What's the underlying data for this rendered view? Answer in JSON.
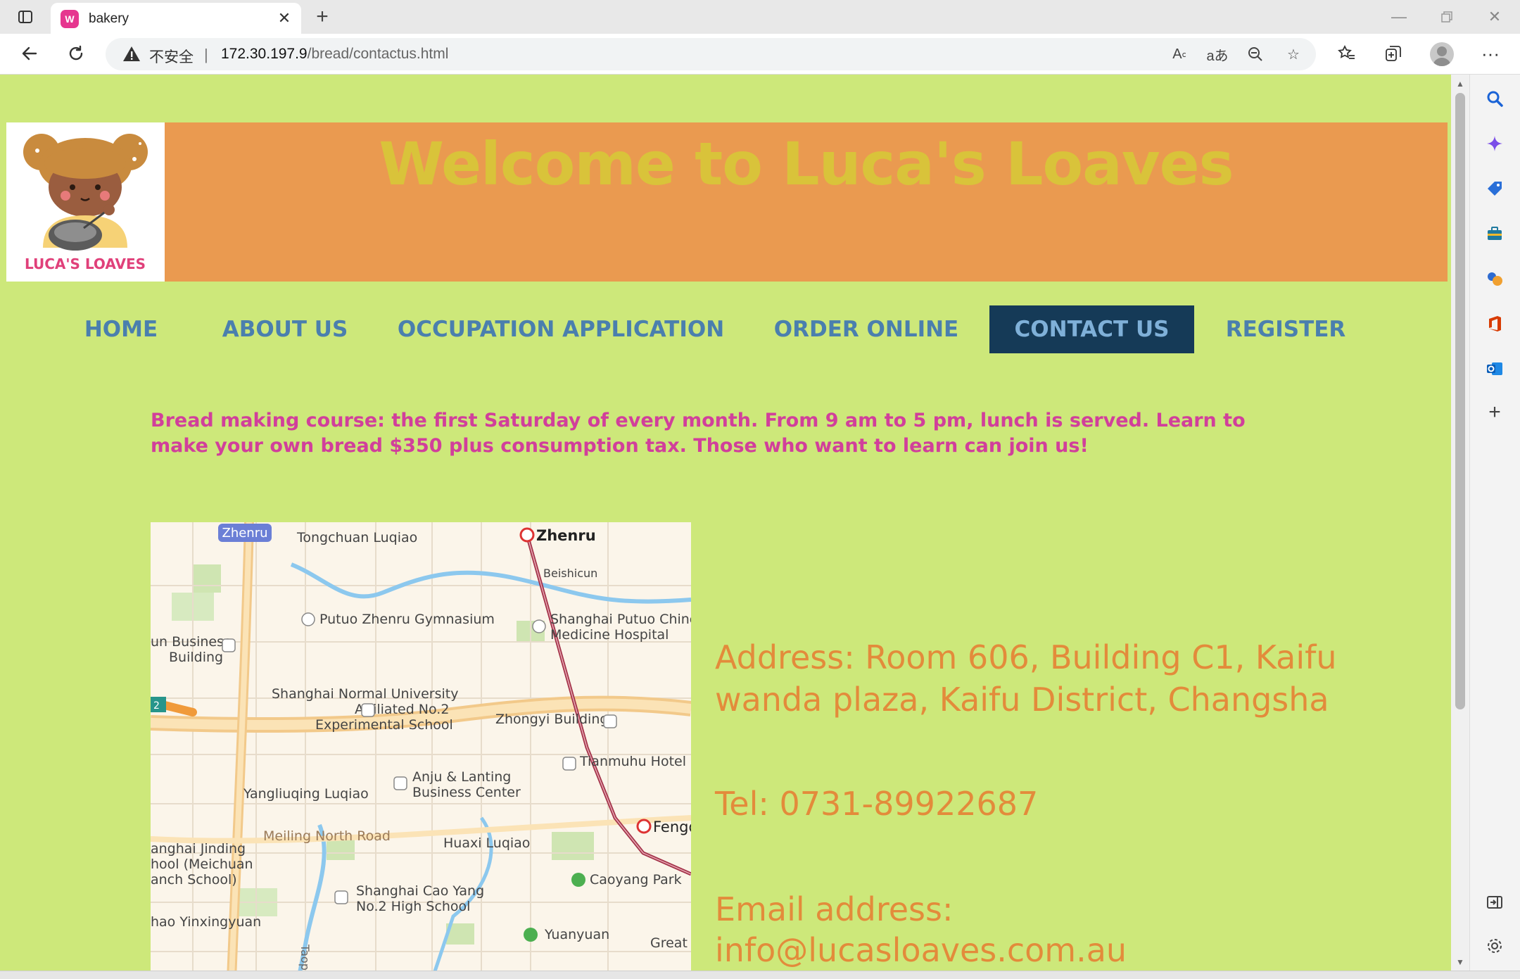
{
  "browser": {
    "tab_title": "bakery",
    "tab_favicon_text": "W",
    "security_label": "不安全",
    "url_host": "172.30.197.9",
    "url_path": "/bread/contactus.html"
  },
  "header": {
    "title": "Welcome to Luca's Loaves",
    "logo_text": "LUCA'S LOAVES"
  },
  "nav": [
    {
      "label": "HOME",
      "active": false
    },
    {
      "label": "ABOUT US",
      "active": false
    },
    {
      "label": "OCCUPATION APPLICATION",
      "active": false
    },
    {
      "label": "ORDER ONLINE",
      "active": false
    },
    {
      "label": "CONTACT US",
      "active": true
    },
    {
      "label": "REGISTER",
      "active": false
    }
  ],
  "promo": "Bread making course: the first Saturday of every month. From 9 am to 5 pm, lunch is served. Learn to make your own bread $350 plus consumption tax. Those who want to learn can join us!",
  "map_labels": {
    "zhenru_badge": "Zhenru",
    "tongchuan": "Tongchuan Luqiao",
    "zhenru_station": "Zhenru",
    "beishicun": "Beishicun",
    "gymnasium": "Putuo Zhenru Gymnasium",
    "hospital_1": "Shanghai Putuo Chines",
    "hospital_2": "Medicine Hospital",
    "business_1": "un Business",
    "business_2": "Building",
    "school_1": "Shanghai Normal University",
    "school_2": "Affiliated No.2",
    "school_3": "Experimental School",
    "zhongyi": "Zhongyi Building",
    "tianmuhu": "Tianmuhu Hotel",
    "anju_1": "Anju & Lanting",
    "anju_2": "Business Center",
    "yangliuqing": "Yangliuqing Luqiao",
    "meiling": "Meiling North Road",
    "huaxi": "Huaxi Luqiao",
    "fengq": "Fengq",
    "jinding_1": "anghai Jinding",
    "jinding_2": "hool (Meichuan",
    "jinding_3": "anch School)",
    "caoyang_park": "Caoyang Park",
    "caoyang_school_1": "Shanghai Cao Yang",
    "caoyang_school_2": "No.2 High School",
    "yinxingyuan": "hao Yinxingyuan",
    "taopu": "Taopu",
    "yuanyuan": "Yuanyuan",
    "great": "Great V",
    "badge_2": "2"
  },
  "contact": {
    "address_line1": "Address: Room 606, Building C1, Kaifu",
    "address_line2": "wanda plaza, Kaifu District, Changsha",
    "tel": "Tel: 0731-89922687",
    "email_label": "Email address:",
    "email": "info@lucasloaves.com.au"
  },
  "colors": {
    "page_bg": "#cde87a",
    "header_bg": "#ea9a50",
    "title": "#d9c33a",
    "nav_text": "#4a7fae",
    "nav_active_bg": "#153a57",
    "promo": "#d13f9b",
    "contact": "#e38b3b"
  },
  "icons": {
    "sidebar": [
      "search-icon",
      "copilot-icon",
      "shopping-tag-icon",
      "tools-icon",
      "games-icon",
      "office-icon",
      "outlook-icon",
      "add-icon",
      "split-screen-icon",
      "settings-icon"
    ]
  }
}
